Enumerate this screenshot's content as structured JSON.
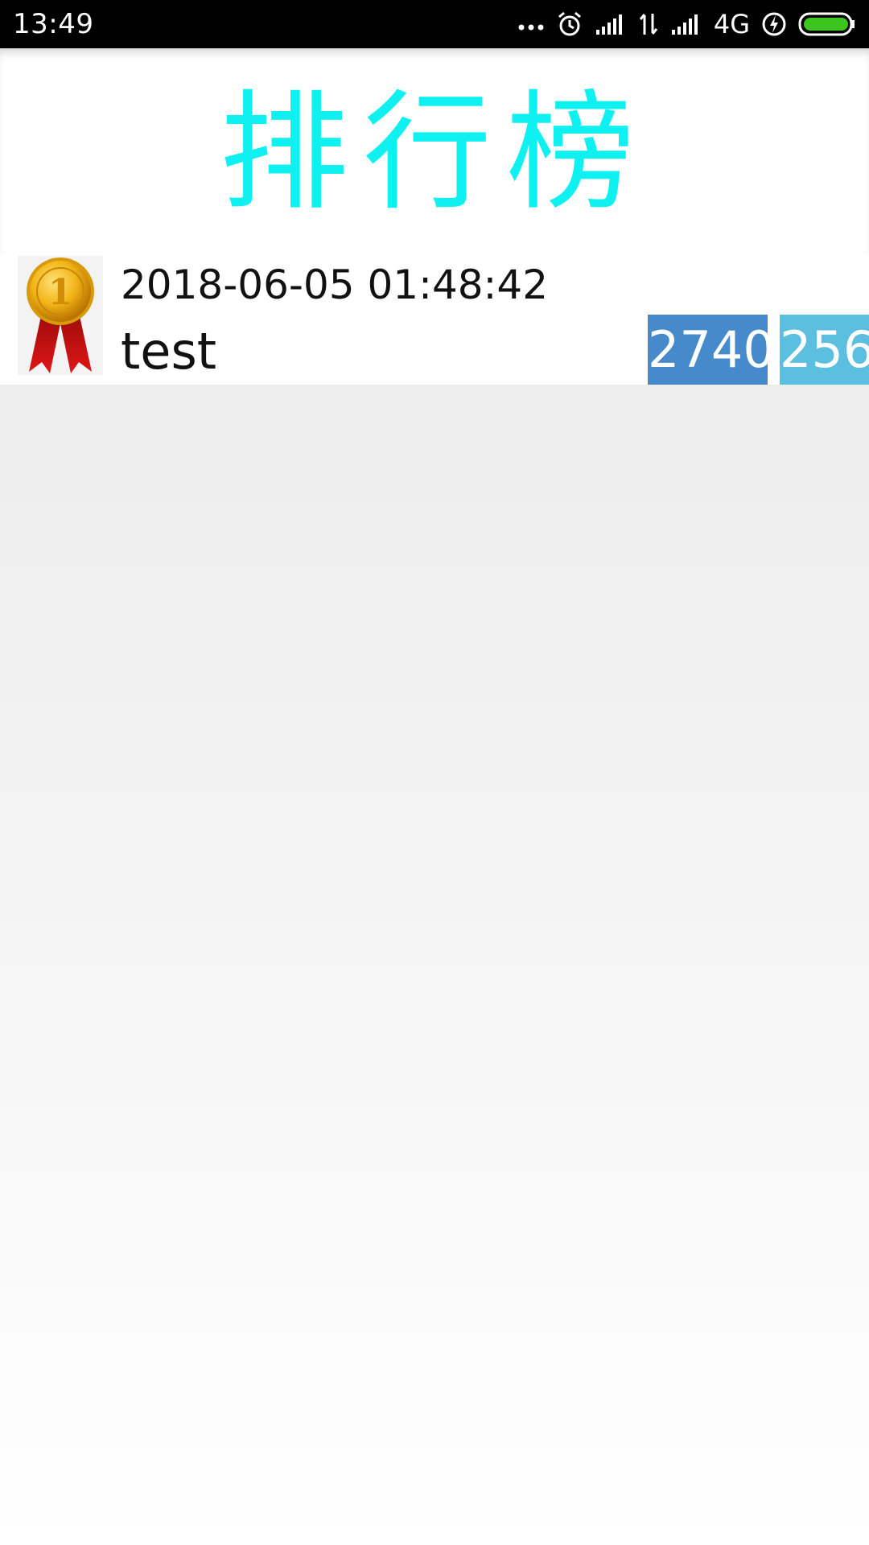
{
  "status_bar": {
    "time": "13:49",
    "network": "4G",
    "icons": [
      "more-dots-icon",
      "alarm-icon",
      "signal-icon",
      "data-transfer-icon",
      "signal-icon",
      "charging-icon",
      "battery-icon"
    ],
    "battery_color": "#3cc61d"
  },
  "header": {
    "title": "排行榜",
    "title_color": "#0ff1f1"
  },
  "leaderboard": {
    "rows": [
      {
        "rank_icon": "gold-medal-icon",
        "time": "2018-06-05 01:48:42",
        "name": "test",
        "score": "2740",
        "second_value": "256",
        "score_color": "#468acb",
        "second_color": "#5bbfe0"
      }
    ]
  }
}
